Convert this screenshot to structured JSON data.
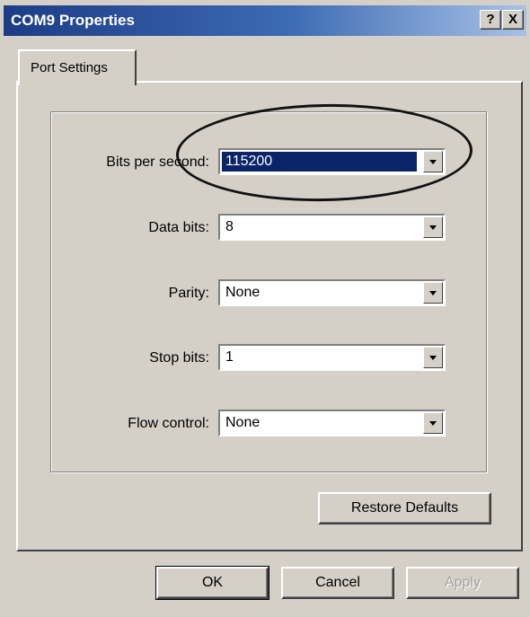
{
  "window": {
    "title": "COM9 Properties",
    "help_label": "?",
    "close_label": "X"
  },
  "tabs": [
    {
      "label": "Port Settings"
    }
  ],
  "settings": [
    {
      "label": "Bits per second:",
      "value": "115200"
    },
    {
      "label": "Data bits:",
      "value": "8"
    },
    {
      "label": "Parity:",
      "value": "None"
    },
    {
      "label": "Stop bits:",
      "value": "1"
    },
    {
      "label": "Flow control:",
      "value": "None"
    }
  ],
  "buttons": {
    "restore": "Restore Defaults",
    "ok": "OK",
    "cancel": "Cancel",
    "apply": "Apply"
  }
}
